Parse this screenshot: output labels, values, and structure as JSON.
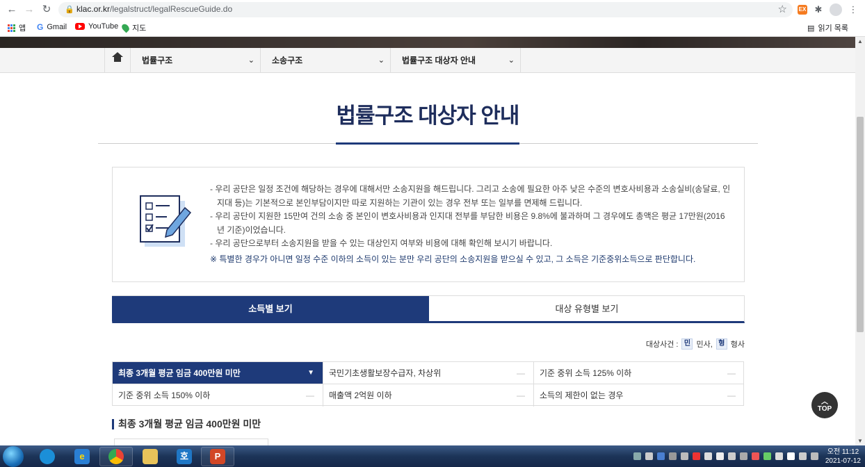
{
  "browser": {
    "url_host": "klac.or.kr",
    "url_path": "/legalstruct/legalRescueGuide.do",
    "bookmarks": [
      "앱",
      "Gmail",
      "YouTube",
      "지도"
    ],
    "reading_list": "읽기 목록",
    "ext_badge": "EX"
  },
  "nav": {
    "items": [
      {
        "label": "법률구조"
      },
      {
        "label": "소송구조"
      },
      {
        "label": "법률구조 대상자 안내"
      }
    ]
  },
  "page": {
    "title": "법률구조 대상자 안내"
  },
  "info": {
    "items": [
      "- 우리 공단은 일정 조건에 해당하는 경우에 대해서만 소송지원을 해드립니다. 그리고 소송에 필요한 아주 낮은 수준의 변호사비용과 소송실비(송달료, 인지대 등)는 기본적으로 본인부담이지만 따로 지원하는 기관이 있는 경우 전부 또는 일부를 면제해 드립니다.",
      "- 우리 공단이 지원한 15만여 건의 소송 중 본인이 변호사비용과 인지대 전부를 부담한 비용은 9.8%에 불과하며 그 경우에도 총액은 평균 17만원(2016년 기준)이었습니다.",
      "- 우리 공단으로부터 소송지원을 받을 수 있는 대상인지 여부와 비용에 대해 확인해 보시기 바랍니다."
    ],
    "note": "※ 특별한 경우가 아니면 일정 수준 이하의 소득이 있는 분만 우리 공단의 소송지원을 받으실 수 있고, 그 소득은 기준중위소득으로 판단합니다."
  },
  "tabs": {
    "active": "소득별 보기",
    "inactive": "대상 유형별 보기"
  },
  "legend": {
    "label": "대상사건 :",
    "civil_tag": "민",
    "civil_label": "민사,",
    "criminal_tag": "형",
    "criminal_label": "형사"
  },
  "categories": {
    "row1": [
      "최종 3개월 평균 임금 400만원 미만",
      "국민기초생활보장수급자, 차상위",
      "기준 중위 소득 125% 이하"
    ],
    "row2": [
      "기준 중위 소득 150% 이하",
      "매출액 2억원 이하",
      "소득의 제한이 없는 경우"
    ],
    "active_marker": "▼",
    "dash": "—"
  },
  "section": {
    "heading": "최종 3개월 평균 임금 400만원 미만"
  },
  "top_button": {
    "arrow": "︿",
    "label": "TOP"
  },
  "taskbar": {
    "clock_line1": "오전 11:12",
    "clock_line2": "2021-07-12",
    "hangul_app": "호"
  },
  "colors": {
    "brand_navy": "#1e3a7a",
    "title_navy": "#1e2d5c"
  }
}
